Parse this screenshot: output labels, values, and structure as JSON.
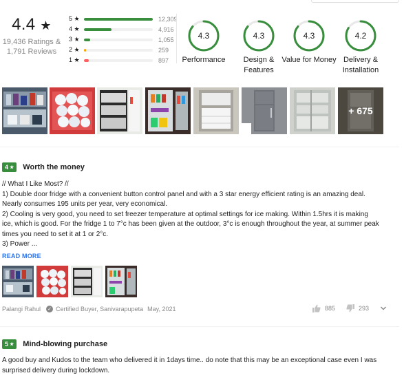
{
  "summary": {
    "average": "4.4",
    "star_symbol": "★",
    "ratings_text": "19,436 Ratings &",
    "reviews_text": "1,791 Reviews"
  },
  "distribution": [
    {
      "label": "5 ★",
      "count": "12,309",
      "fraction": 1.0,
      "color": "#388e3c"
    },
    {
      "label": "4 ★",
      "count": "4,916",
      "fraction": 0.4,
      "color": "#388e3c"
    },
    {
      "label": "3 ★",
      "count": "1,055",
      "fraction": 0.09,
      "color": "#388e3c"
    },
    {
      "label": "2 ★",
      "count": "259",
      "fraction": 0.03,
      "color": "#ff9f00"
    },
    {
      "label": "1 ★",
      "count": "897",
      "fraction": 0.07,
      "color": "#ff6161"
    }
  ],
  "metrics": [
    {
      "value": "4.3",
      "line1": "Performance",
      "line2": "",
      "fraction": 0.86
    },
    {
      "value": "4.3",
      "line1": "Design &",
      "line2": "Features",
      "fraction": 0.86
    },
    {
      "value": "4.3",
      "line1": "Value for Money",
      "line2": "",
      "fraction": 0.86
    },
    {
      "value": "4.2",
      "line1": "Delivery &",
      "line2": "Installation",
      "fraction": 0.84
    }
  ],
  "ring_color": "#388e3c",
  "gallery": {
    "more_label": "+ 675"
  },
  "reviews": [
    {
      "rating": "4",
      "title": "Worth the money",
      "lines": [
        "// What I Like Most? //",
        "1) Double door fridge with a convenient button control panel and with a 3 star energy efficient rating is an amazing deal.",
        "Nearly consumes 195 units per year, very economical.",
        "2) Cooling is very good, you need to set freezer temperature at optimal settings for ice making. Within 1.5hrs it is making",
        "ice, which is good. For the fridge 1 to 7°c has been given at the outdoor, 3°c is enough throughout the year, at summer peak",
        "times you need to set it at 1 or 2°c.",
        "3) Power ..."
      ],
      "read_more": "READ MORE",
      "author": "Palangi Rahul",
      "certified": "Certified Buyer, Sanivarapupeta",
      "date": "May, 2021",
      "likes": "885",
      "dislikes": "293"
    },
    {
      "rating": "5",
      "title": "Mind-blowing purchase",
      "lines": [
        "A good buy and Kudos to the team who delivered it in 1days time.. do note that this may be an exceptional case even I was",
        "surprised delivery during lockdown."
      ]
    }
  ],
  "icons": {
    "check": "✓",
    "star": "★"
  }
}
